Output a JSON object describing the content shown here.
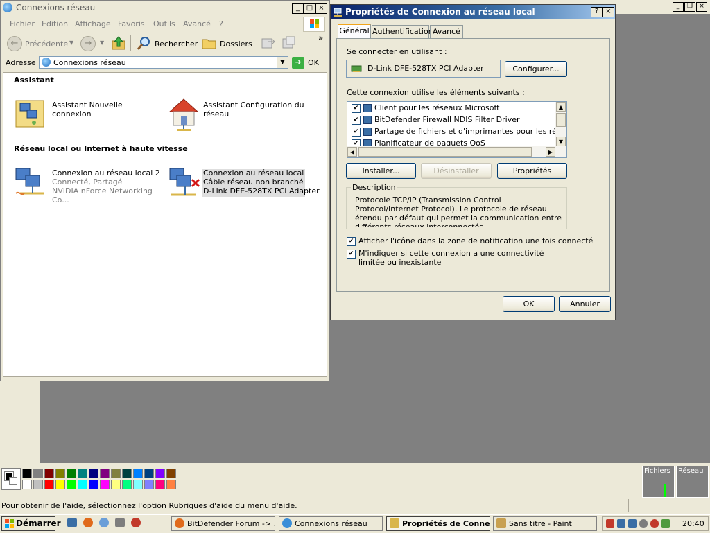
{
  "explorer": {
    "title": "Connexions réseau",
    "menu": [
      "Fichier",
      "Edition",
      "Affichage",
      "Favoris",
      "Outils",
      "Avancé",
      "?"
    ],
    "toolbar": {
      "back": "Précédente",
      "search": "Rechercher",
      "folders": "Dossiers",
      "chevron": "»"
    },
    "address": {
      "label": "Adresse",
      "value": "Connexions réseau",
      "go": "OK"
    },
    "groups": [
      {
        "title": "Assistant",
        "items": [
          {
            "line1": "Assistant Nouvelle connexion"
          },
          {
            "line1": "Assistant Configuration du",
            "line2": "réseau"
          }
        ]
      },
      {
        "title": "Réseau local ou Internet à haute vitesse",
        "items": [
          {
            "line1": "Connexion au réseau local 2",
            "line2": "Connecté, Partagé",
            "line3": "NVIDIA nForce Networking Co..."
          },
          {
            "line1": "Connexion au réseau local",
            "line2": "Câble réseau non branché",
            "line3": "D-Link DFE-528TX PCI Adapter"
          }
        ]
      }
    ]
  },
  "dialog": {
    "title": "Propriétés de Connexion au réseau local",
    "tabs": [
      "Général",
      "Authentification",
      "Avancé"
    ],
    "connect_using_label": "Se connecter en utilisant :",
    "adapter": "D-Link DFE-528TX PCI Adapter",
    "configure_button": "Configurer...",
    "components_label": "Cette connexion utilise les éléments suivants :",
    "components": [
      "Client pour les réseaux Microsoft",
      "BitDefender Firewall NDIS Filter Driver",
      "Partage de fichiers et d'imprimantes pour les réseaux M",
      "Planificateur de paquets QoS"
    ],
    "buttons": {
      "install": "Installer...",
      "uninstall": "Désinstaller",
      "properties": "Propriétés"
    },
    "description_label": "Description",
    "description": "Protocole TCP/IP (Transmission Control Protocol/Internet Protocol). Le protocole de réseau étendu par défaut qui permet la communication entre différents réseaux interconnectés.",
    "checkbox1": "Afficher l'icône dans la zone de notification une fois connecté",
    "checkbox2": "M'indiquer si cette connexion a une connectivité limitée ou inexistante",
    "ok": "OK",
    "cancel": "Annuler",
    "help": "?",
    "close": "×"
  },
  "paint": {
    "status": "Pour obtenir de l'aide, sélectionnez l'option Rubriques d'aide du menu d'aide.",
    "graph_labels": [
      "Fichiers",
      "Réseau"
    ],
    "palette_top": [
      "#000000",
      "#808080",
      "#800000",
      "#808000",
      "#008000",
      "#008080",
      "#000080",
      "#800080",
      "#808040",
      "#004040",
      "#0080ff",
      "#004080",
      "#8000ff",
      "#804000"
    ],
    "palette_bottom": [
      "#ffffff",
      "#c0c0c0",
      "#ff0000",
      "#ffff00",
      "#00ff00",
      "#00ffff",
      "#0000ff",
      "#ff00ff",
      "#ffff80",
      "#00ff80",
      "#80ffff",
      "#8080ff",
      "#ff0080",
      "#ff8040"
    ]
  },
  "taskbar": {
    "start": "Démarrer",
    "tasks": [
      {
        "label": "BitDefender Forum -> ...",
        "active": false
      },
      {
        "label": "Connexions réseau",
        "active": false
      },
      {
        "label": "Propriétés de Conne...",
        "active": true
      },
      {
        "label": "Sans titre - Paint",
        "active": false
      }
    ],
    "clock": "20:40"
  }
}
